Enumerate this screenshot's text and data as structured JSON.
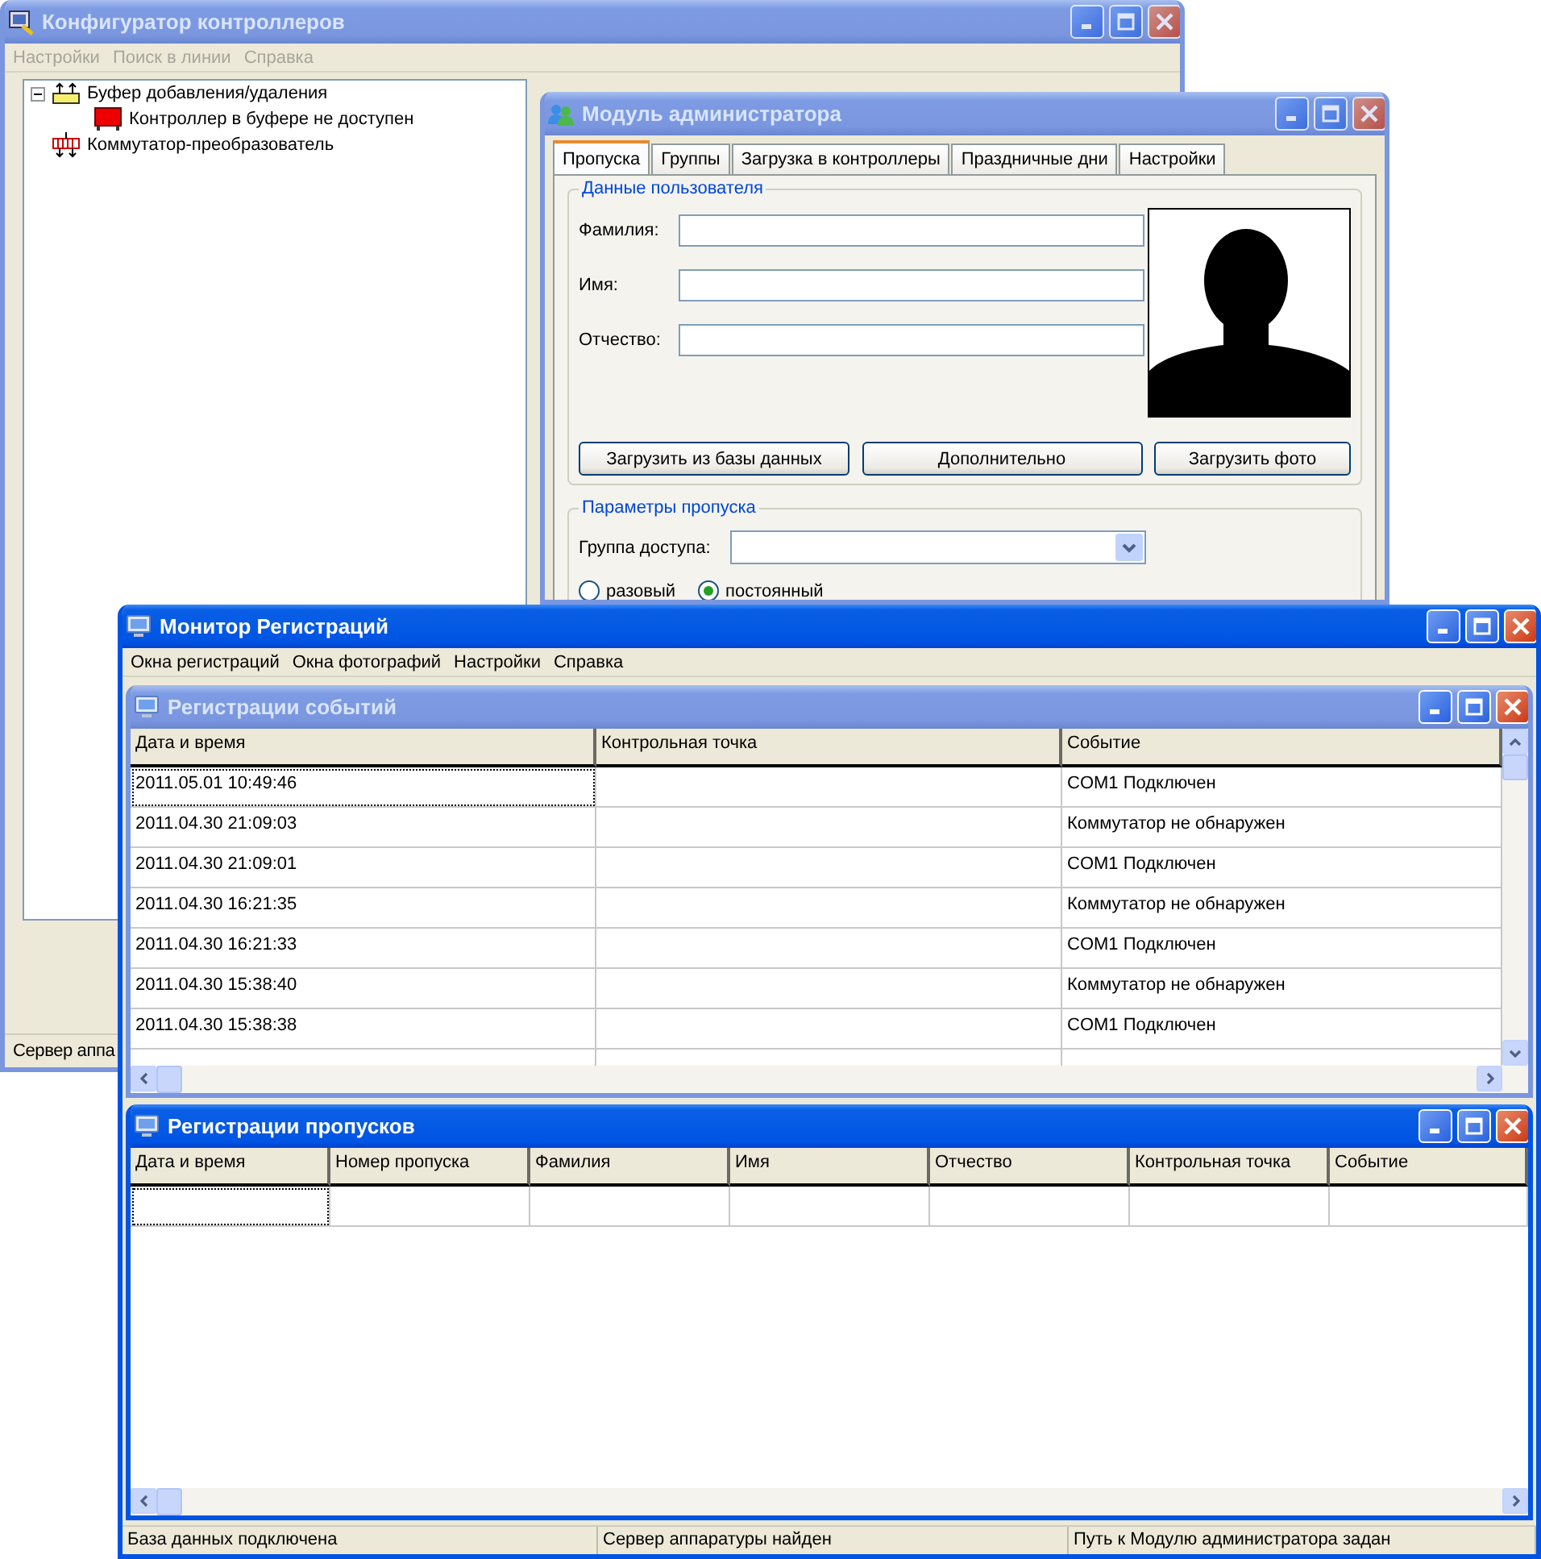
{
  "configurator": {
    "title": "Конфигуратор контроллеров",
    "active": false,
    "menu": [
      {
        "label": "Настройки",
        "disabled": true
      },
      {
        "label": "Поиск в линии",
        "disabled": true
      },
      {
        "label": "Справка",
        "disabled": true
      }
    ],
    "tree": [
      {
        "label": "Буфер добавления/удаления",
        "kind": "buffer",
        "expanded": true,
        "children": [
          {
            "label": "Контроллер в буфере не доступен",
            "kind": "controller"
          }
        ]
      },
      {
        "label": "Коммутатор-преобразователь",
        "kind": "converter"
      }
    ],
    "status": "Сервер аппа"
  },
  "admin": {
    "title": "Модуль администратора",
    "active": false,
    "tabs": [
      {
        "label": "Пропуска",
        "selected": true
      },
      {
        "label": "Группы",
        "selected": false
      },
      {
        "label": "Загрузка в контроллеры",
        "selected": false
      },
      {
        "label": "Праздничные дни",
        "selected": false
      },
      {
        "label": "Настройки",
        "selected": false
      }
    ],
    "user_group": {
      "legend": "Данные пользователя",
      "fields": [
        {
          "label": "Фамилия:"
        },
        {
          "label": "Имя:"
        },
        {
          "label": "Отчество:"
        }
      ],
      "buttons": [
        "Загрузить из базы данных",
        "Дополнительно",
        "Загрузить фото"
      ]
    },
    "pass_group": {
      "legend": "Параметры пропуска",
      "access_label": "Группа доступа:",
      "radios": [
        {
          "label": "разовый",
          "selected": false
        },
        {
          "label": "постоянный",
          "selected": true
        }
      ]
    }
  },
  "monitor": {
    "title": "Монитор Регистраций",
    "active": true,
    "menu": [
      "Окна регистраций",
      "Окна фотографий",
      "Настройки",
      "Справка"
    ],
    "events": {
      "title": "Регистрации событий",
      "active": false,
      "columns": [
        "Дата и время",
        "Контрольная точка",
        "Событие"
      ],
      "rows": [
        {
          "datetime": "2011.05.01 10:49:46",
          "event": "COM1 Подключен",
          "focused": true
        },
        {
          "datetime": "2011.04.30 21:09:03",
          "event": "Коммутатор не обнаружен",
          "focused": false
        },
        {
          "datetime": "2011.04.30 21:09:01",
          "event": "COM1 Подключен",
          "focused": false
        },
        {
          "datetime": "2011.04.30 16:21:35",
          "event": "Коммутатор не обнаружен",
          "focused": false
        },
        {
          "datetime": "2011.04.30 16:21:33",
          "event": "COM1 Подключен",
          "focused": false
        },
        {
          "datetime": "2011.04.30 15:38:40",
          "event": "Коммутатор не обнаружен",
          "focused": false
        },
        {
          "datetime": "2011.04.30 15:38:38",
          "event": "COM1 Подключен",
          "focused": false
        }
      ]
    },
    "passes": {
      "title": "Регистрации пропусков",
      "active": true,
      "columns": [
        "Дата и время",
        "Номер пропуска",
        "Фамилия",
        "Имя",
        "Отчество",
        "Контрольная точка",
        "Событие"
      ],
      "rows": [
        {
          "focused": true
        }
      ]
    },
    "status_bar": [
      "База данных подключена",
      "Сервер аппаратуры найден",
      "Путь к Модулю администратора задан"
    ]
  }
}
